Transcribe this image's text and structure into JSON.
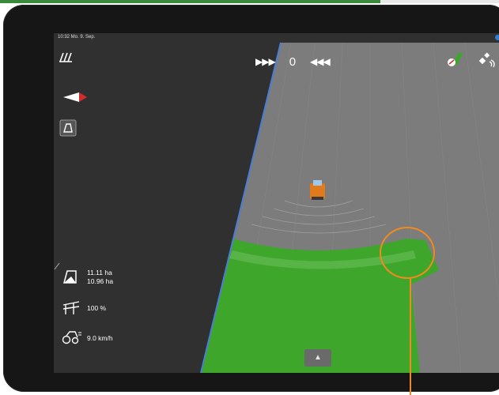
{
  "status_bar": {
    "time_date": "10:32  Mo. 9. Sep."
  },
  "header": {
    "left_arrows": "▶▶▶",
    "counter_value": "0",
    "right_arrows": "◀◀◀"
  },
  "stats": {
    "area_total": "11.11 ha",
    "area_worked": "10.96 ha",
    "section_percent": "100 %",
    "speed": "9.0 km/h"
  },
  "bottom_button": {
    "icon": "up-arrow",
    "label": "▲"
  },
  "colors": {
    "worked_area": "#3fa62c",
    "field_unworked": "#7a7a7a",
    "boundary_line": "#4a7fd8",
    "callout": "#f08a1e",
    "status_dot": "#2f7fd8"
  }
}
